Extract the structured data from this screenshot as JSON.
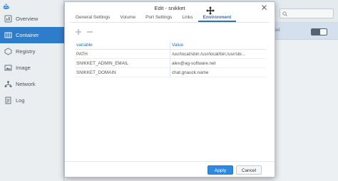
{
  "background": {
    "sidebar": {
      "items": [
        {
          "label": "Overview",
          "icon": "overview-icon"
        },
        {
          "label": "Container",
          "icon": "container-icon",
          "active": true
        },
        {
          "label": "Registry",
          "icon": "registry-icon"
        },
        {
          "label": "Image",
          "icon": "image-icon"
        },
        {
          "label": "Network",
          "icon": "network-icon"
        },
        {
          "label": "Log",
          "icon": "log-icon"
        }
      ]
    },
    "container_row": {
      "status": "pped"
    },
    "colors": {
      "accent": "#2f80d1",
      "row_highlight": "#dce8f5"
    }
  },
  "dialog": {
    "title": "Edit - snikket",
    "tabs": [
      {
        "label": "General Settings"
      },
      {
        "label": "Volume"
      },
      {
        "label": "Port Settings"
      },
      {
        "label": "Links"
      },
      {
        "label": "Environment",
        "active": true
      }
    ],
    "table": {
      "headers": {
        "variable": "variable",
        "value": "Value"
      },
      "rows": [
        {
          "variable": "PATH",
          "value": "/usr/local/sbin:/usr/local/bin:/usr/sbi..."
        },
        {
          "variable": "SNIKKET_ADMIN_EMAIL",
          "value": "alex@ag-software.net"
        },
        {
          "variable": "SNIKKET_DOMAIN",
          "value": "chat.gnauck.name"
        }
      ]
    },
    "buttons": {
      "apply": "Apply",
      "cancel": "Cancel"
    },
    "colors": {
      "primary": "#2e8ae0",
      "link": "#2a72b8"
    }
  }
}
